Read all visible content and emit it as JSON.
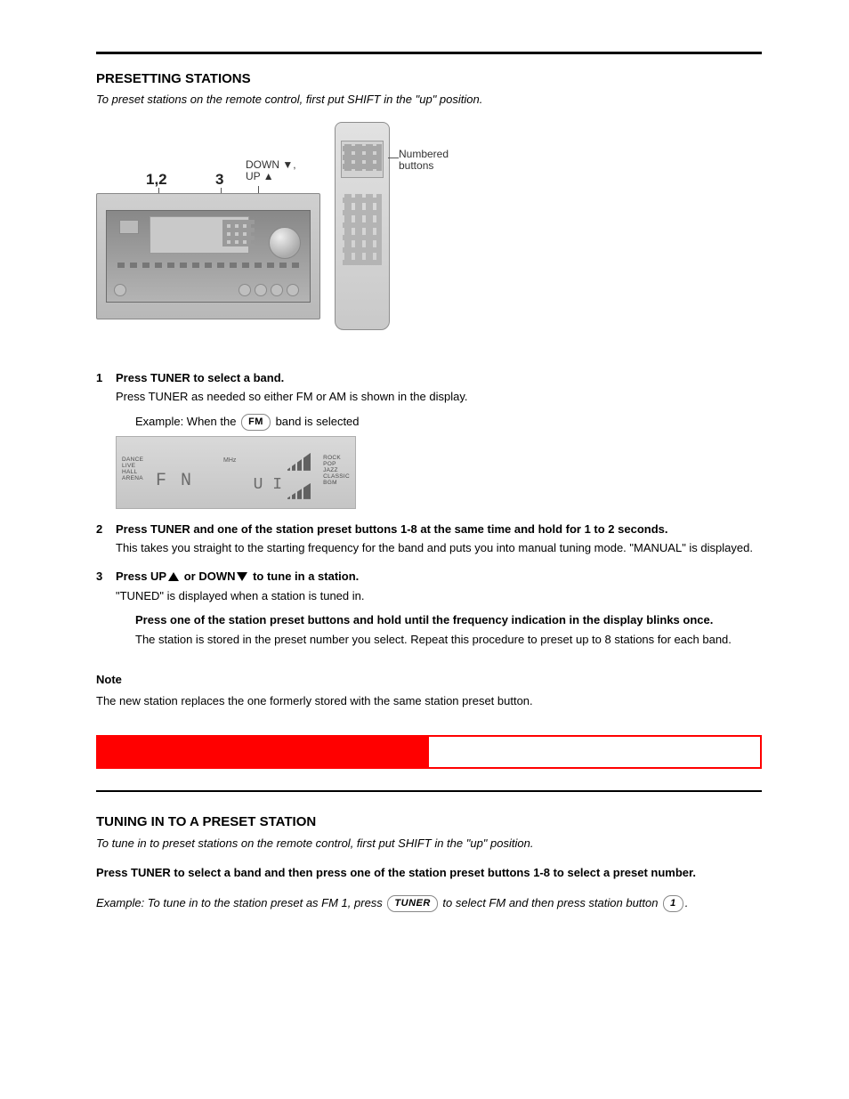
{
  "rule": {},
  "fig_top": {
    "lbl12": "1,2",
    "lbl3": "3",
    "down_up1": "DOWN ▼,",
    "down_up2": "UP ▲",
    "numbered1": "Numbered",
    "numbered2": "buttons"
  },
  "heading": "PRESETTING STATIONS",
  "note_heading": "To preset stations on the remote control, first put SHIFT in the \"up\" position.",
  "steps": [
    {
      "lead": "Press TUNER to select a band.",
      "body": "Press TUNER as needed so either FM or AM is shown in the display."
    },
    {
      "lead": "Press TUNER and one of the station preset buttons 1-8 at the same time and hold for 1 to 2 seconds.",
      "body": "This takes you straight to the starting frequency for the band and puts you into manual tuning mode. \"MANUAL\" is displayed."
    },
    {
      "lead_prefix": "Press UP",
      "lead_mid": " or DOWN",
      "lead_suffix": " to tune in a station.",
      "body": "\"TUNED\" is displayed when a station is tuned in."
    }
  ],
  "panel_caption_pre": "Example: When the ",
  "panel_caption_pill": "FM",
  "panel_caption_post": " band is selected",
  "panel": {
    "left": [
      "DANCE",
      "LIVE",
      "HALL",
      "ARENA"
    ],
    "right": [
      "ROCK",
      "POP",
      "JAZZ",
      "CLASSIC",
      "BGM"
    ],
    "mhz": "MHz",
    "digits": "F N",
    "u": "U  I"
  },
  "sub3": {
    "lead": "Press one of the station preset buttons and hold until the frequency indication in the display blinks once.",
    "body": "The station is stored in the preset number you select. Repeat this procedure to preset up to 8 stations for each band."
  },
  "note": {
    "label": "Note",
    "text": "The new station replaces the one formerly stored with the same station preset button."
  },
  "sec2": {
    "heading": "TUNING IN TO A PRESET STATION",
    "sub": "To tune in to preset stations on the remote control, first put SHIFT in the \"up\" position.",
    "instr_lead": "Press TUNER to select a band and then press one of the station preset buttons 1-8 to select a preset number.",
    "ex_pre": "Example: To tune in to the station preset as FM 1, press ",
    "pill1": "TUNER",
    "ex_mid": " to select FM and then press station button ",
    "pill2": "1",
    "ex_post": "."
  }
}
